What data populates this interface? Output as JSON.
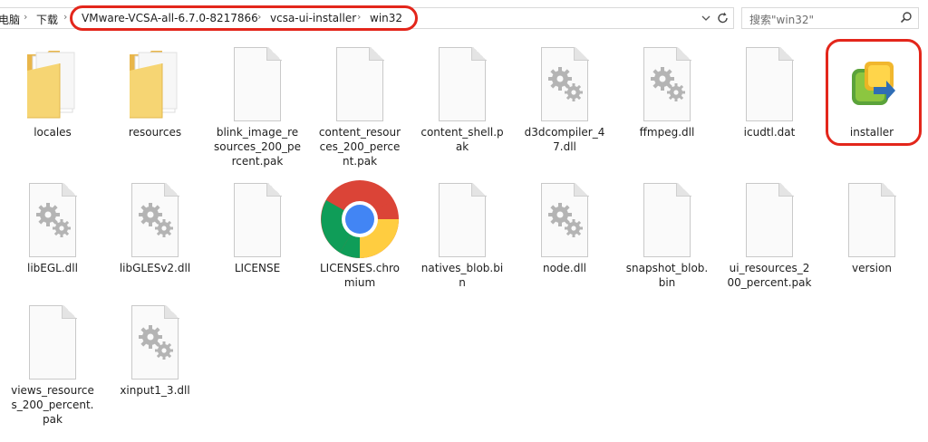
{
  "breadcrumb": {
    "items": [
      "电脑",
      "下载",
      "VMware-VCSA-all-6.7.0-8217866",
      "vcsa-ui-installer",
      "win32"
    ],
    "separator": "›"
  },
  "toolbar": {
    "dropdown_icon": "chevron-down-icon",
    "refresh_icon": "refresh-icon"
  },
  "search": {
    "placeholder": "搜索\"win32\"",
    "icon": "search-icon"
  },
  "colors": {
    "highlight": "#e3261b",
    "folder": "#f5d06b",
    "chrome_blue": "#4285f4"
  },
  "files": [
    {
      "name": "locales",
      "type": "folder"
    },
    {
      "name": "resources",
      "type": "folder"
    },
    {
      "name": "blink_image_resources_200_percent.pak",
      "type": "document"
    },
    {
      "name": "content_resources_200_percent.pak",
      "type": "document"
    },
    {
      "name": "content_shell.pak",
      "type": "document"
    },
    {
      "name": "d3dcompiler_47.dll",
      "type": "dll"
    },
    {
      "name": "ffmpeg.dll",
      "type": "dll"
    },
    {
      "name": "icudtl.dat",
      "type": "document"
    },
    {
      "name": "installer",
      "type": "vmware-installer"
    },
    {
      "name": "libEGL.dll",
      "type": "dll"
    },
    {
      "name": "libGLESv2.dll",
      "type": "dll"
    },
    {
      "name": "LICENSE",
      "type": "document"
    },
    {
      "name": "LICENSES.chromium",
      "type": "chrome-html"
    },
    {
      "name": "natives_blob.bin",
      "type": "document"
    },
    {
      "name": "node.dll",
      "type": "dll"
    },
    {
      "name": "snapshot_blob.bin",
      "type": "document"
    },
    {
      "name": "ui_resources_200_percent.pak",
      "type": "document"
    },
    {
      "name": "version",
      "type": "document"
    },
    {
      "name": "views_resources_200_percent.pak",
      "type": "document"
    },
    {
      "name": "xinput1_3.dll",
      "type": "dll"
    }
  ]
}
